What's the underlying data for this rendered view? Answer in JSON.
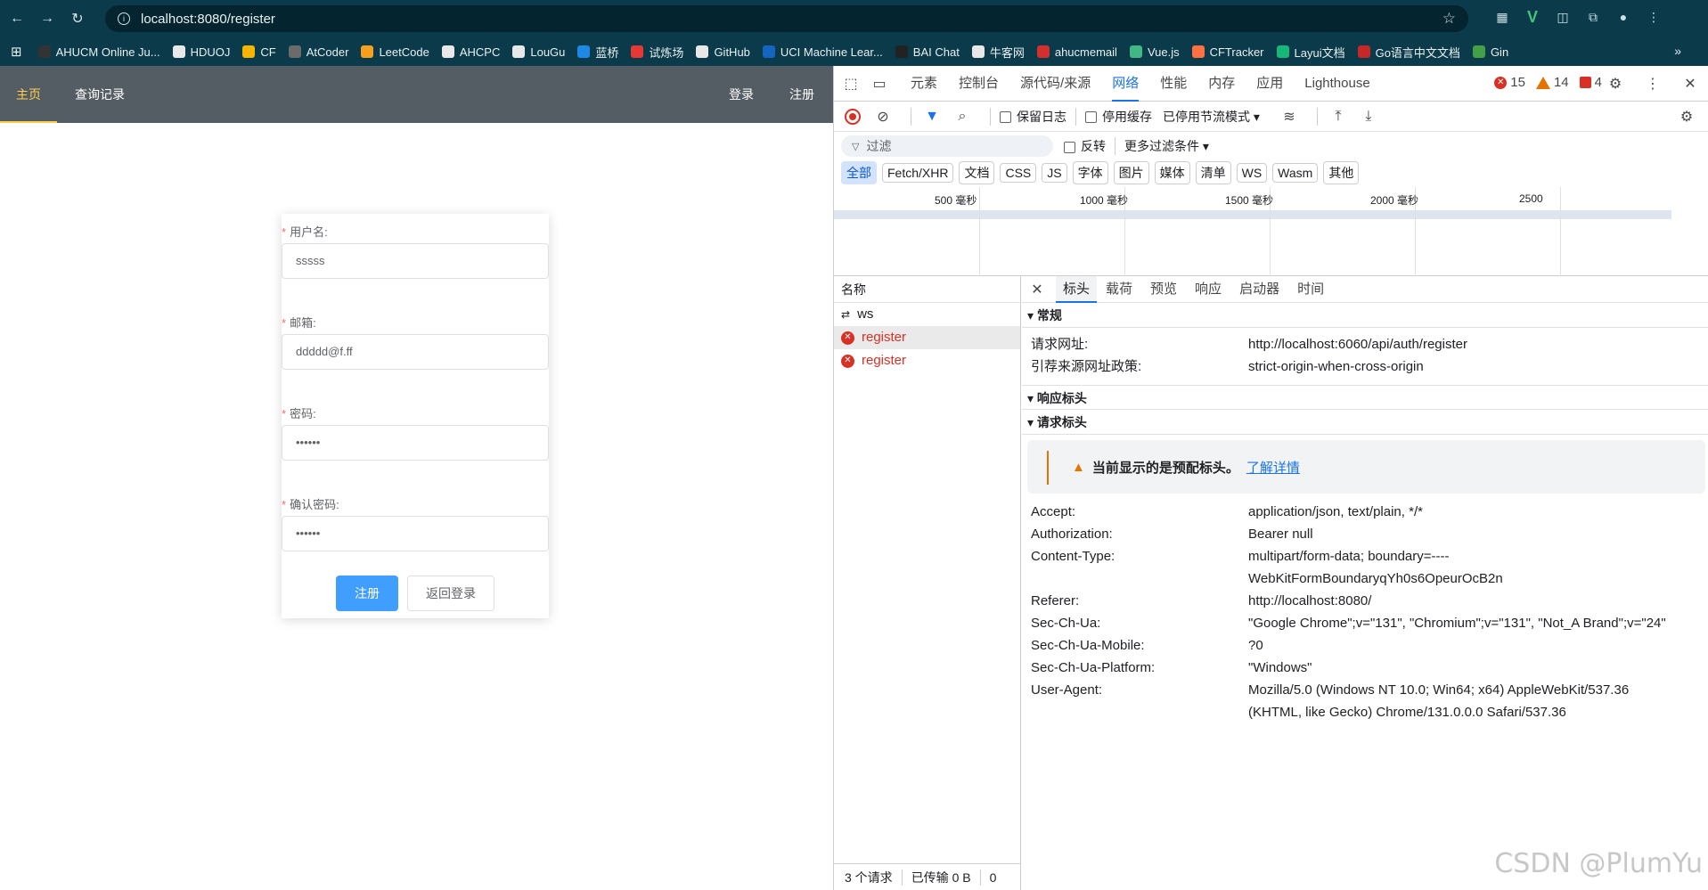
{
  "browser": {
    "url": "localhost:8080/register",
    "bookmarks": [
      {
        "label": "AHUCM Online Ju...",
        "color": "#333333"
      },
      {
        "label": "HDUOJ",
        "color": "#e8e8e8"
      },
      {
        "label": "CF",
        "color": "#f7b500"
      },
      {
        "label": "AtCoder",
        "color": "#6b6b6b"
      },
      {
        "label": "LeetCode",
        "color": "#f89f1b"
      },
      {
        "label": "AHCPC",
        "color": "#e8e8e8"
      },
      {
        "label": "LouGu",
        "color": "#e8e8e8"
      },
      {
        "label": "蓝桥",
        "color": "#1e88e5"
      },
      {
        "label": "试炼场",
        "color": "#e53935"
      },
      {
        "label": "GitHub",
        "color": "#e8e8e8"
      },
      {
        "label": "UCI Machine Lear...",
        "color": "#1565c0"
      },
      {
        "label": "BAI Chat",
        "color": "#222222"
      },
      {
        "label": "牛客网",
        "color": "#e8e8e8"
      },
      {
        "label": "ahucmemail",
        "color": "#d32f2f"
      },
      {
        "label": "Vue.js",
        "color": "#41b883"
      },
      {
        "label": "CFTracker",
        "color": "#ff7043"
      },
      {
        "label": "Layui文档",
        "color": "#16b777"
      },
      {
        "label": "Go语言中文文档",
        "color": "#c62828"
      },
      {
        "label": "Gin",
        "color": "#43a047"
      }
    ]
  },
  "app": {
    "nav": {
      "home": "主页",
      "history": "查询记录",
      "login": "登录",
      "register": "注册"
    },
    "form": {
      "username_label": "用户名:",
      "username_value": "sssss",
      "email_label": "邮箱:",
      "email_value": "ddddd@f.ff",
      "password_label": "密码:",
      "password_value": "••••••",
      "confirm_label": "确认密码:",
      "confirm_value": "••••••",
      "required_mark": "*",
      "submit_label": "注册",
      "back_label": "返回登录"
    }
  },
  "devtools": {
    "tabs": [
      "元素",
      "控制台",
      "源代码/来源",
      "网络",
      "性能",
      "内存",
      "应用",
      "Lighthouse"
    ],
    "active_tab": "网络",
    "errors": "15",
    "warnings": "14",
    "issues": "4",
    "toolbar": {
      "preserve_log": "保留日志",
      "disable_cache": "停用缓存",
      "throttle": "已停用节流模式"
    },
    "filter": {
      "placeholder": "过滤",
      "invert": "反转",
      "more_filters": "更多过滤条件"
    },
    "types": [
      "全部",
      "Fetch/XHR",
      "文档",
      "CSS",
      "JS",
      "字体",
      "图片",
      "媒体",
      "清单",
      "WS",
      "Wasm",
      "其他"
    ],
    "timeline_labels": [
      "500 毫秒",
      "1000 毫秒",
      "1500 毫秒",
      "2000 毫秒",
      "2500"
    ],
    "requests": {
      "header": "名称",
      "rows": [
        {
          "name": "ws",
          "type": "ws"
        },
        {
          "name": "register",
          "type": "err"
        },
        {
          "name": "register",
          "type": "err"
        }
      ],
      "footer_count": "3 个请求",
      "footer_transfer": "已传输 0 B",
      "footer_extra": "0"
    },
    "details": {
      "tabs": [
        "标头",
        "载荷",
        "预览",
        "响应",
        "启动器",
        "时间"
      ],
      "general_title": "常规",
      "general": [
        {
          "k": "请求网址:",
          "v": "http://localhost:6060/api/auth/register"
        },
        {
          "k": "引荐来源网址政策:",
          "v": "strict-origin-when-cross-origin"
        }
      ],
      "response_title": "响应标头",
      "request_title": "请求标头",
      "warning_text": "当前显示的是预配标头。",
      "warning_link": "了解详情",
      "request_headers": [
        {
          "k": "Accept:",
          "v": "application/json, text/plain, */*"
        },
        {
          "k": "Authorization:",
          "v": "Bearer null"
        },
        {
          "k": "Content-Type:",
          "v": "multipart/form-data; boundary=----WebKitFormBoundaryqYh0s6OpeurOcB2n"
        },
        {
          "k": "Referer:",
          "v": "http://localhost:8080/"
        },
        {
          "k": "Sec-Ch-Ua:",
          "v": "\"Google Chrome\";v=\"131\", \"Chromium\";v=\"131\", \"Not_A Brand\";v=\"24\""
        },
        {
          "k": "Sec-Ch-Ua-Mobile:",
          "v": "?0"
        },
        {
          "k": "Sec-Ch-Ua-Platform:",
          "v": "\"Windows\""
        },
        {
          "k": "User-Agent:",
          "v": "Mozilla/5.0 (Windows NT 10.0; Win64; x64) AppleWebKit/537.36 (KHTML, like Gecko) Chrome/131.0.0.0 Safari/537.36"
        }
      ]
    }
  },
  "watermark": "CSDN @PlumYu"
}
